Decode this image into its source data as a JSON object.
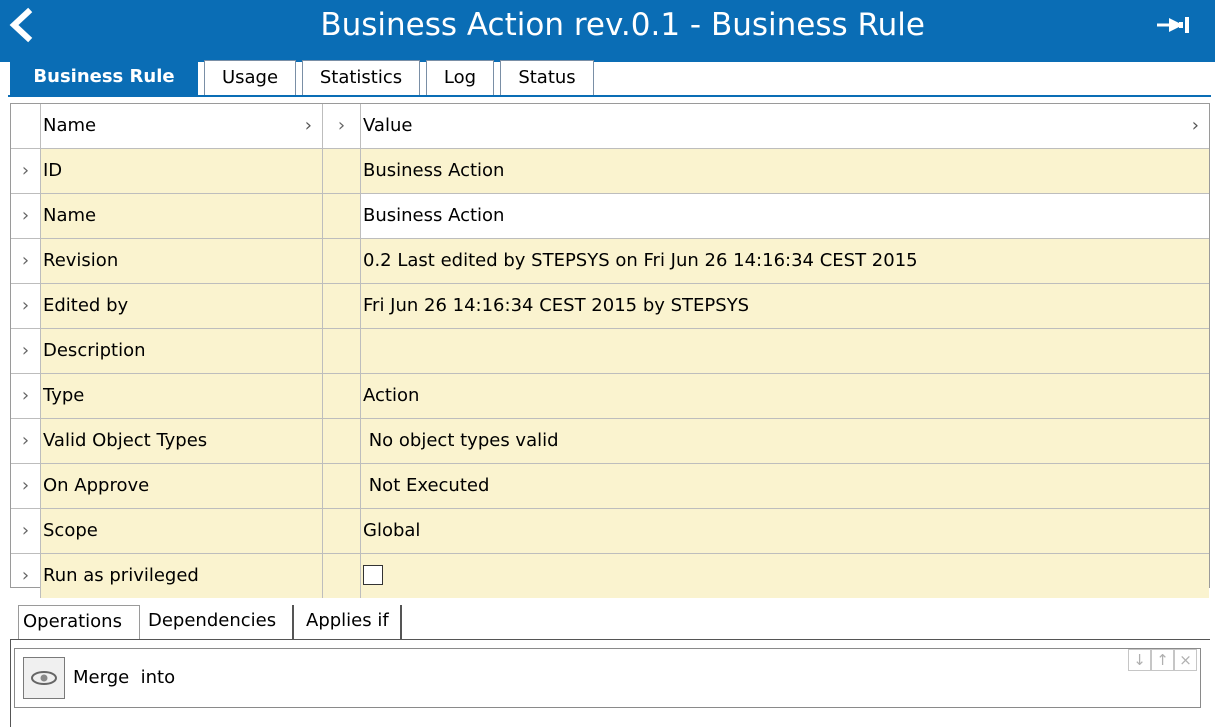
{
  "window": {
    "title": "Business Action rev.0.1 - Business Rule",
    "accent": "#0a6db5"
  },
  "tabs": [
    {
      "label": "Business Rule"
    },
    {
      "label": "Usage"
    },
    {
      "label": "Statistics"
    },
    {
      "label": "Log"
    },
    {
      "label": "Status"
    }
  ],
  "grid": {
    "header": {
      "name": "Name",
      "value": "Value"
    },
    "rows": [
      {
        "name": "ID",
        "value": "Business Action"
      },
      {
        "name": "Name",
        "value": "Business Action"
      },
      {
        "name": "Revision",
        "value": "0.2 Last edited by STEPSYS on Fri Jun 26 14:16:34 CEST 2015"
      },
      {
        "name": "Edited by",
        "value": "Fri Jun 26 14:16:34 CEST 2015 by STEPSYS"
      },
      {
        "name": "Description",
        "value": ""
      },
      {
        "name": "Type",
        "value": "Action"
      },
      {
        "name": "Valid Object Types",
        "value": " No object types valid"
      },
      {
        "name": "On Approve",
        "value": " Not Executed"
      },
      {
        "name": "Scope",
        "value": "Global"
      },
      {
        "name": "Run as privileged",
        "checked": false
      }
    ]
  },
  "bottom_tabs": [
    {
      "label": "Operations"
    },
    {
      "label": "Dependencies"
    },
    {
      "label": "Applies if"
    }
  ],
  "operations": {
    "item": "Merge  into"
  },
  "icons": {
    "back": "chevron-left-icon",
    "pin": "pin-icon",
    "eye": "eye-icon"
  }
}
